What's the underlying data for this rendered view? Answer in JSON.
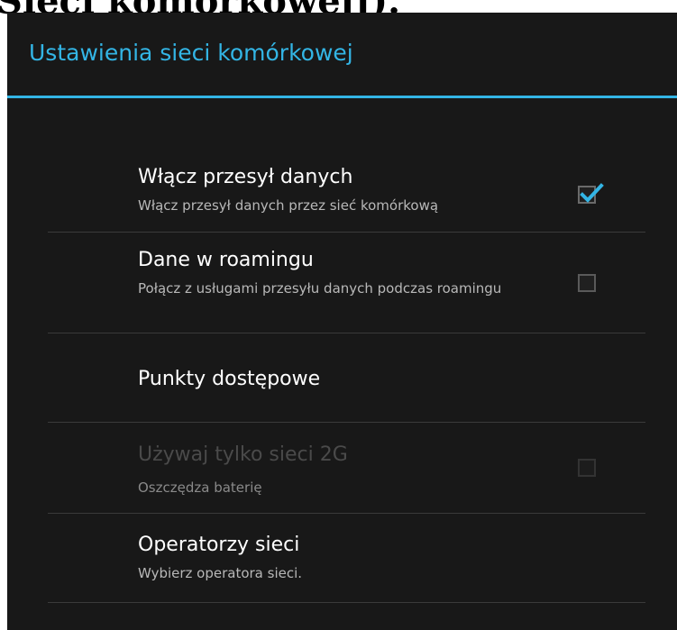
{
  "caption": "Sieci komórkowej]).",
  "header": {
    "title": "Ustawienia sieci komórkowej"
  },
  "items": [
    {
      "title": "Włącz przesył danych",
      "summary": "Włącz przesył danych przez sieć komórkową",
      "checked": true,
      "enabled": true
    },
    {
      "title": "Dane w roamingu",
      "summary": "Połącz z usługami przesyłu danych podczas roamingu",
      "checked": false,
      "enabled": true
    },
    {
      "title": "Punkty dostępowe"
    },
    {
      "title": "Używaj tylko sieci 2G",
      "summary": "Oszczędza baterię",
      "checked": false,
      "enabled": false
    },
    {
      "title": "Operatorzy sieci",
      "summary": "Wybierz operatora sieci."
    }
  ],
  "colors": {
    "accent": "#33b5e5",
    "background": "#181818"
  }
}
